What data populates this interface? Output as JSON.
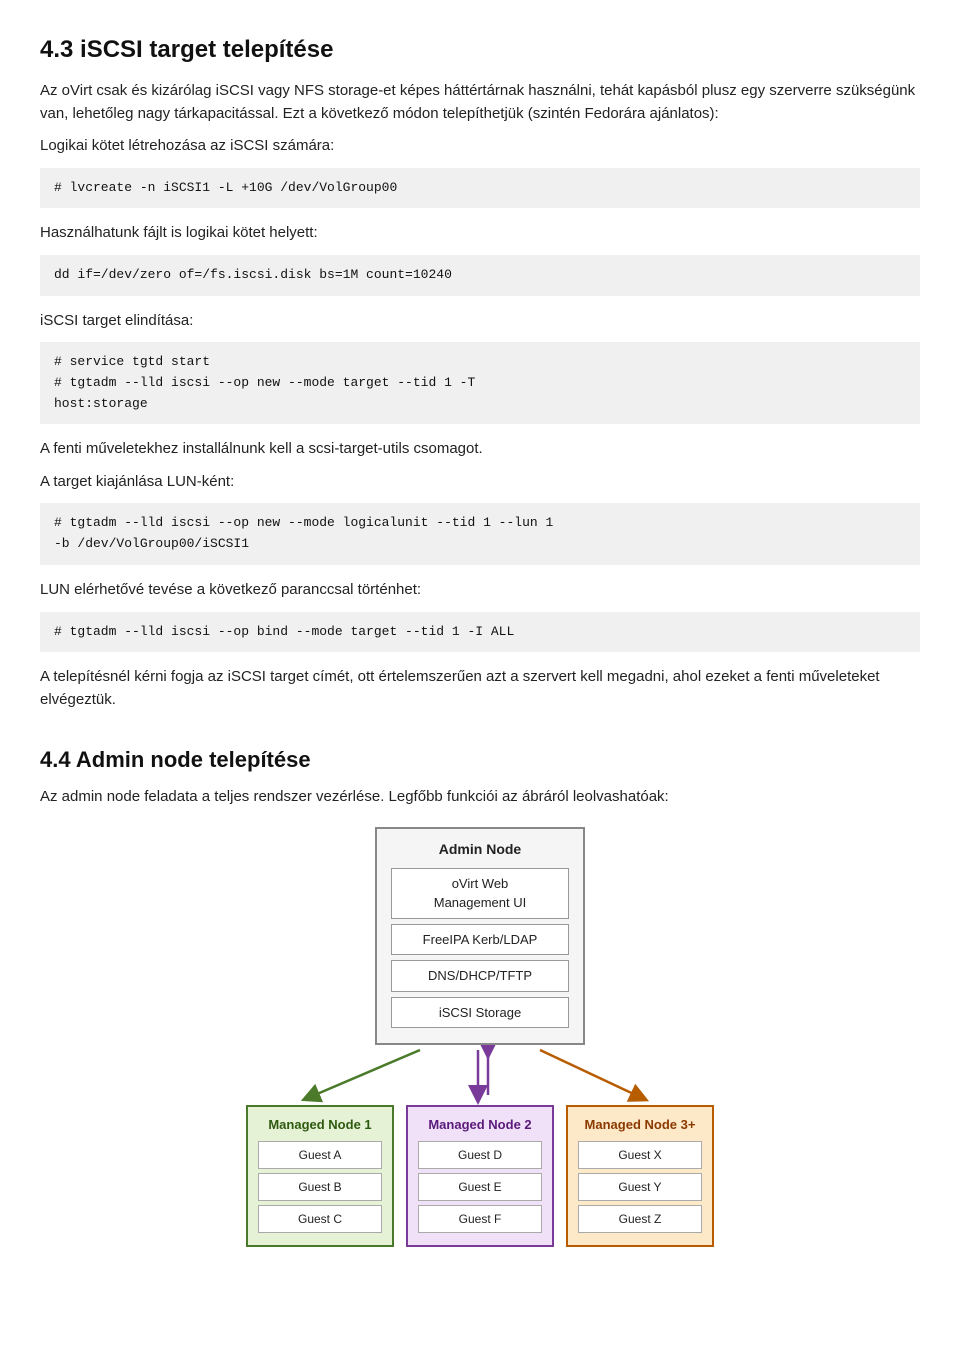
{
  "heading": {
    "h1": "4.3 iSCSI target telepítése",
    "h2": "4.4 Admin node telepítése"
  },
  "paragraphs": {
    "intro": "Az oVirt csak és kizárólag iSCSI vagy NFS storage-et képes háttértárnak használni, tehát kapásból plusz egy szerverre szükségünk van, lehetőleg nagy tárkapacitással. Ezt a következő módon telepíthetjük (szintén Fedorára ajánlatos):",
    "logical_vol_label": "Logikai kötet létrehozása az iSCSI számára:",
    "code_lvcreate": "# lvcreate -n iSCSI1 -L +10G /dev/VolGroup00",
    "file_label": "Használhatunk fájlt is logikai kötet helyett:",
    "code_dd": "dd if=/dev/zero of=/fs.iscsi.disk bs=1M count=10240",
    "iscsi_label": "iSCSI target elindítása:",
    "code_iscsi_start": "# service tgtd start\n# tgtadm --lld iscsi --op new --mode target --tid 1 -T\nhost:storage",
    "note_scsi": "A fenti műveletekhez installálnunk kell a scsi-target-utils csomagot.",
    "lun_label": "A target kiajánlása LUN-ként:",
    "code_lun": "# tgtadm --lld iscsi --op new --mode logicalunit --tid 1 --lun 1\n-b /dev/VolGroup00/iSCSI1",
    "lun_enable_label": "LUN elérhetővé tevése a következő paranccsal történhet:",
    "code_bind": "# tgtadm --lld iscsi --op bind --mode target --tid 1 -I ALL",
    "install_note": "A telepítésnél kérni fogja az iSCSI target címét, ott értelemszerűen azt a szervert kell megadni, ahol ezeket a fenti műveleteket elvégeztük.",
    "admin_intro": "Az admin node feladata a teljes rendszer vezérlése. Legfőbb funkciói az ábráról leolvashatóak:"
  },
  "diagram": {
    "admin_node": {
      "title": "Admin Node",
      "items": [
        "oVirt Web\nManagement UI",
        "FreeIPA Kerb/LDAP",
        "DNS/DHCP/TFTP",
        "iSCSI Storage"
      ]
    },
    "managed_nodes": [
      {
        "title": "Managed Node 1",
        "color": "green",
        "guests": [
          "Guest A",
          "Guest B",
          "Guest C"
        ]
      },
      {
        "title": "Managed Node 2",
        "color": "purple",
        "guests": [
          "Guest D",
          "Guest E",
          "Guest F"
        ]
      },
      {
        "title": "Managed Node 3+",
        "color": "orange",
        "guests": [
          "Guest X",
          "Guest Y",
          "Guest Z"
        ]
      }
    ]
  }
}
